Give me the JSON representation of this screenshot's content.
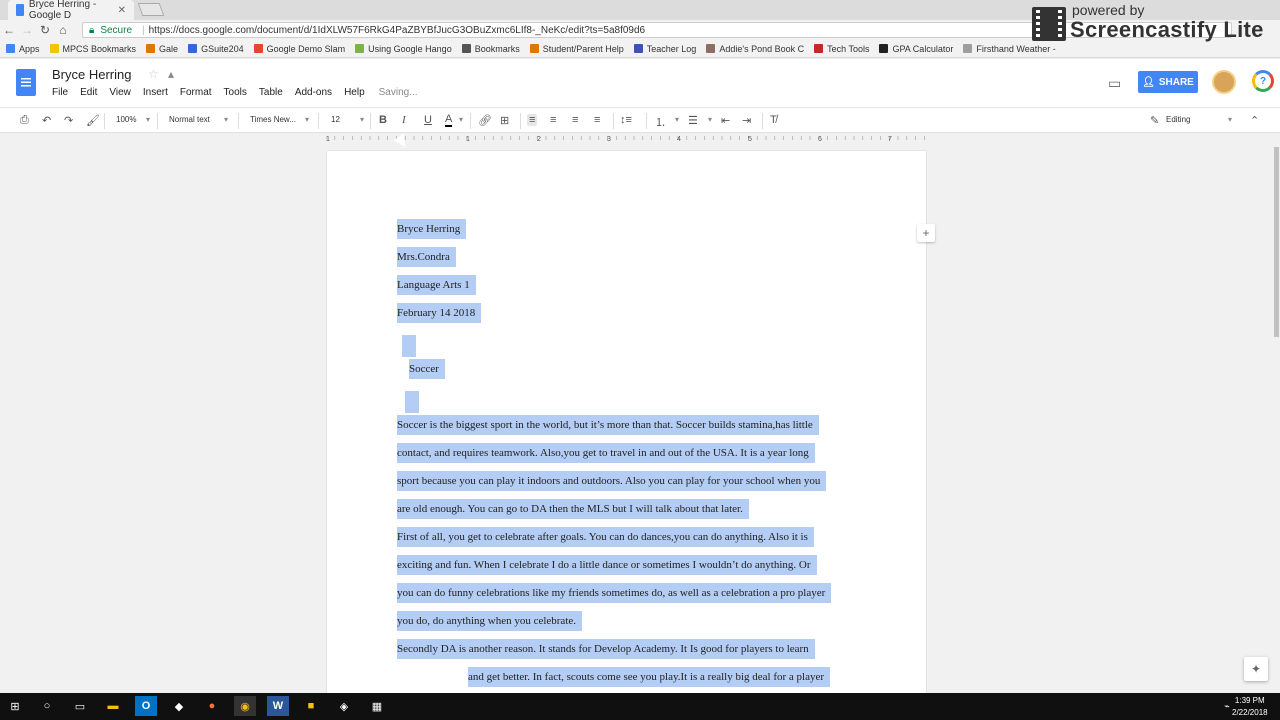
{
  "browser": {
    "tab_title": "Bryce Herring - Google D",
    "tab_close": "✕",
    "url_secure_label": "Secure",
    "url": "https://docs.google.com/document/d/1IdXLW57F6RkG4PaZBYBfJucG3OBuZxmc6LIf8-_NeKc/edit?ts=5a8f09d6",
    "bookmarks": [
      {
        "label": "Apps",
        "color": "#4285f4"
      },
      {
        "label": "MPCS Bookmarks",
        "color": "#f4c20d"
      },
      {
        "label": "Gale",
        "color": "#e37400"
      },
      {
        "label": "GSuite204",
        "color": "#3367d6"
      },
      {
        "label": "Google Demo Slam",
        "color": "#ea4335"
      },
      {
        "label": "Using Google Hango",
        "color": "#7cb342"
      },
      {
        "label": "Bookmarks",
        "color": "#555555"
      },
      {
        "label": "Student/Parent Help",
        "color": "#e37400"
      },
      {
        "label": "Teacher Log",
        "color": "#3f51b5"
      },
      {
        "label": "Addie's Pond Book C",
        "color": "#8d6e63"
      },
      {
        "label": "Tech Tools",
        "color": "#c62828"
      },
      {
        "label": "GPA Calculator",
        "color": "#212121"
      },
      {
        "label": "Firsthand Weather - ",
        "color": "#9e9e9e"
      }
    ]
  },
  "watermark": {
    "powered": "powered by",
    "brand": "Screencastify Lite"
  },
  "docs": {
    "title": "Bryce Herring",
    "menu": [
      "File",
      "Edit",
      "View",
      "Insert",
      "Format",
      "Tools",
      "Table",
      "Add-ons",
      "Help"
    ],
    "saving": "Saving...",
    "share": "SHARE",
    "toolbar": {
      "zoom": "100%",
      "style": "Normal text",
      "font": "Times New...",
      "size": "12",
      "mode": "Editing"
    },
    "ruler_numbers": [
      "1",
      "1",
      "2",
      "3",
      "4",
      "5",
      "6",
      "7"
    ]
  },
  "document": {
    "lines": [
      "Bryce Herring",
      "Mrs.Condra",
      "Language Arts 1",
      "February  14  2018",
      "",
      "Soccer",
      "",
      "Soccer is the biggest sport in the world, but it’s more than that. Soccer builds stamina,has little",
      "contact, and requires teamwork. Also,you get to travel in and out of the USA. It is a year long",
      "sport because you can play it indoors and outdoors. Also you can play for your school when you",
      "are old enough. You can go to DA then the MLS but I will talk about that later.",
      "First of all, you get to celebrate after goals. You can do dances,you can do anything. Also it is",
      "exciting and fun. When I celebrate I do a little dance or sometimes I wouldn’t do anything. Or",
      "you can do funny celebrations like my friends sometimes do, as well as a celebration a pro player",
      "you do, do anything when you celebrate.",
      "Secondly DA is another reason. It stands for Develop Academy. It Is good for players to learn",
      "and get better. In fact, scouts come see you play.It is a really big deal for a player"
    ]
  },
  "taskbar": {
    "time": "1:39 PM",
    "date": "2/22/2018"
  }
}
